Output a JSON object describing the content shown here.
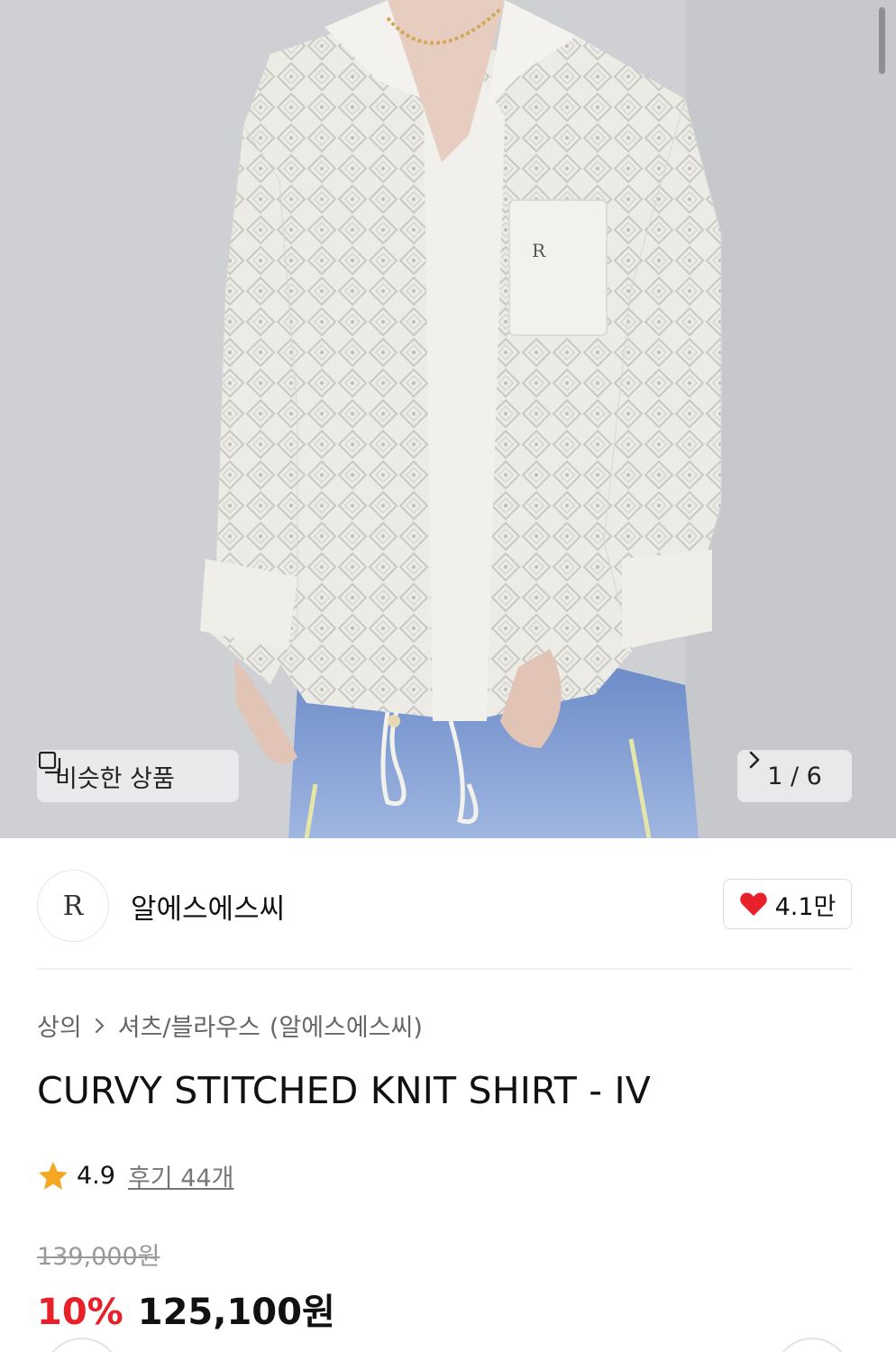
{
  "gallery": {
    "similar_label": "비슷한 상품",
    "page_indicator": "1 / 6"
  },
  "brand": {
    "logo_text": "R",
    "name": "알에스에스씨",
    "likes": "4.1만"
  },
  "breadcrumb": {
    "category1": "상의",
    "category2": "셔츠/블라우스",
    "brand": "(알에스에스씨)"
  },
  "product": {
    "title": "CURVY STITCHED KNIT SHIRT - IV",
    "rating": "4.9",
    "reviews": "후기 44개",
    "original_price": "139,000원",
    "discount": "10%",
    "sale_price": "125,100원"
  },
  "colors": {
    "discount_red": "#e8202a",
    "heart_red": "#e8202a",
    "star_orange": "#f5a623"
  }
}
